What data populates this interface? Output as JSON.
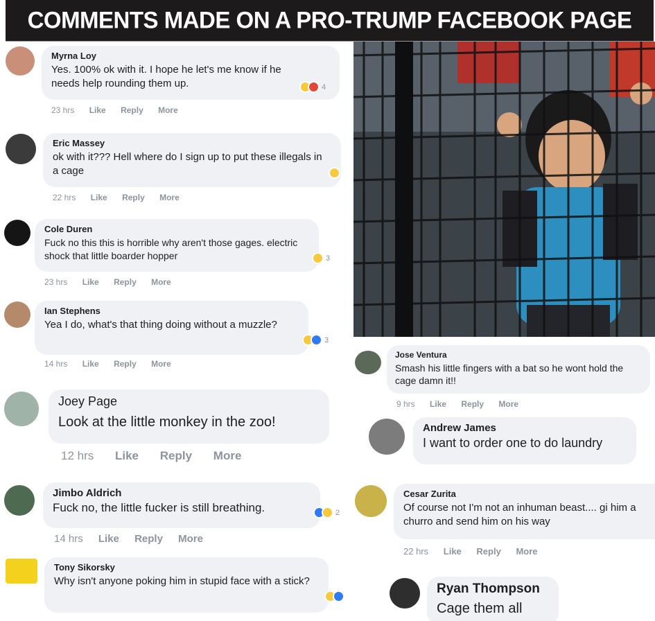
{
  "header": {
    "title": "COMMENTS MADE ON A PRO-TRUMP FACEBOOK PAGE"
  },
  "labels": {
    "like": "Like",
    "reply": "Reply",
    "more": "More"
  },
  "comments": [
    {
      "name": "Myrna Loy",
      "text": "Yes. 100% ok with it. I hope he let's me know if he needs help rounding them up.",
      "time": "23 hrs",
      "reactions": "4"
    },
    {
      "name": "Eric Massey",
      "text": "ok with it??? Hell where do I sign up to put these illegals in a cage",
      "time": "22 hrs",
      "reactions": ""
    },
    {
      "name": "Cole Duren",
      "text": "Fuck no this this is horrible why aren't those gages. electric shock that little boarder hopper",
      "time": "23 hrs",
      "reactions": "3"
    },
    {
      "name": "Ian Stephens",
      "text": "Yea I do, what's that thing doing without a muzzle?",
      "time": "14 hrs",
      "reactions": "3"
    },
    {
      "name": "Joey Page",
      "text": "Look at the little monkey in the zoo!",
      "time": "12 hrs",
      "reactions": ""
    },
    {
      "name": "Jimbo Aldrich",
      "text": "Fuck no, the little fucker is still breathing.",
      "time": "14 hrs",
      "reactions": "2"
    },
    {
      "name": "Tony Sikorsky",
      "text": "Why isn't anyone poking him in stupid face with a stick?",
      "time": "",
      "reactions": ""
    },
    {
      "name": "Jose Ventura",
      "text": "Smash his little fingers with a bat so he wont hold the cage damn it!!",
      "time": "9 hrs",
      "reactions": ""
    },
    {
      "name": "Andrew James",
      "text": "I want to order one to do laundry",
      "time": "",
      "reactions": ""
    },
    {
      "name": "Cesar Zurita",
      "text": "Of course not I'm not an inhuman beast.... gi him a churro and send him on his way",
      "time": "22 hrs",
      "reactions": ""
    },
    {
      "name": "Ryan Thompson",
      "text": "Cage them all",
      "time": "",
      "reactions": ""
    }
  ],
  "colors": {
    "banner": "#1c1a1b",
    "bubble": "#eff1f5",
    "muted": "#8d949e",
    "haha": "#f7c93b",
    "angry": "#e4473a",
    "like": "#2f7af5"
  }
}
